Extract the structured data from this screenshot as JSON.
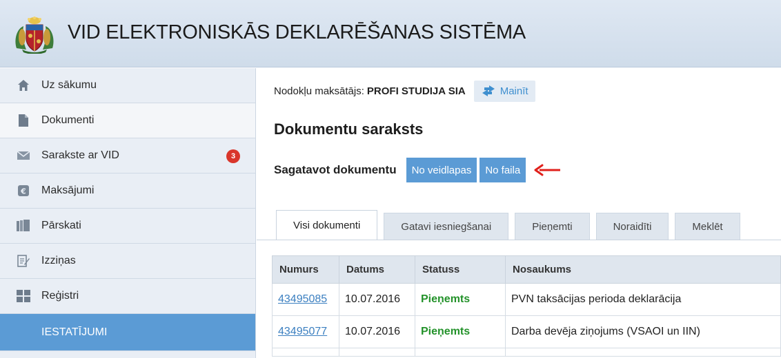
{
  "header": {
    "title": "VID ELEKTRONISKĀS DEKLARĒŠANAS SISTĒMA"
  },
  "sidebar": {
    "items": [
      {
        "label": "Uz sākumu",
        "icon": "home-icon"
      },
      {
        "label": "Dokumenti",
        "icon": "document-icon"
      },
      {
        "label": "Sarakste ar VID",
        "icon": "envelope-icon",
        "badge": "3"
      },
      {
        "label": "Maksājumi",
        "icon": "payment-icon"
      },
      {
        "label": "Pārskati",
        "icon": "reports-icon"
      },
      {
        "label": "Izziņas",
        "icon": "certificate-icon"
      },
      {
        "label": "Reģistri",
        "icon": "grid-icon"
      },
      {
        "label": "IESTATĪJUMI"
      }
    ]
  },
  "main": {
    "taxpayer_label": "Nodokļu maksātājs:",
    "taxpayer_name": "PROFI STUDIJA SIA",
    "change_label": "Mainīt",
    "page_title": "Dokumentu saraksts",
    "prepare_label": "Sagatavot dokumentu",
    "btn_from_form": "No veidlapas",
    "btn_from_file": "No faila",
    "tabs": [
      {
        "label": "Visi dokumenti"
      },
      {
        "label": "Gatavi iesniegšanai"
      },
      {
        "label": "Pieņemti"
      },
      {
        "label": "Noraidīti"
      },
      {
        "label": "Meklēt"
      }
    ],
    "table": {
      "headers": [
        "Numurs",
        "Datums",
        "Statuss",
        "Nosaukums"
      ],
      "rows": [
        {
          "number": "43495085",
          "date": "10.07.2016",
          "status": "Pieņemts",
          "name": "PVN taksācijas perioda deklarācija"
        },
        {
          "number": "43495077",
          "date": "10.07.2016",
          "status": "Pieņemts",
          "name": "Darba devēja ziņojums (VSAOI un IIN)"
        }
      ]
    }
  },
  "colors": {
    "accent": "#5b9bd5",
    "status_accepted": "#23922a",
    "badge": "#d9362b",
    "annotation_arrow": "#e0201b"
  }
}
